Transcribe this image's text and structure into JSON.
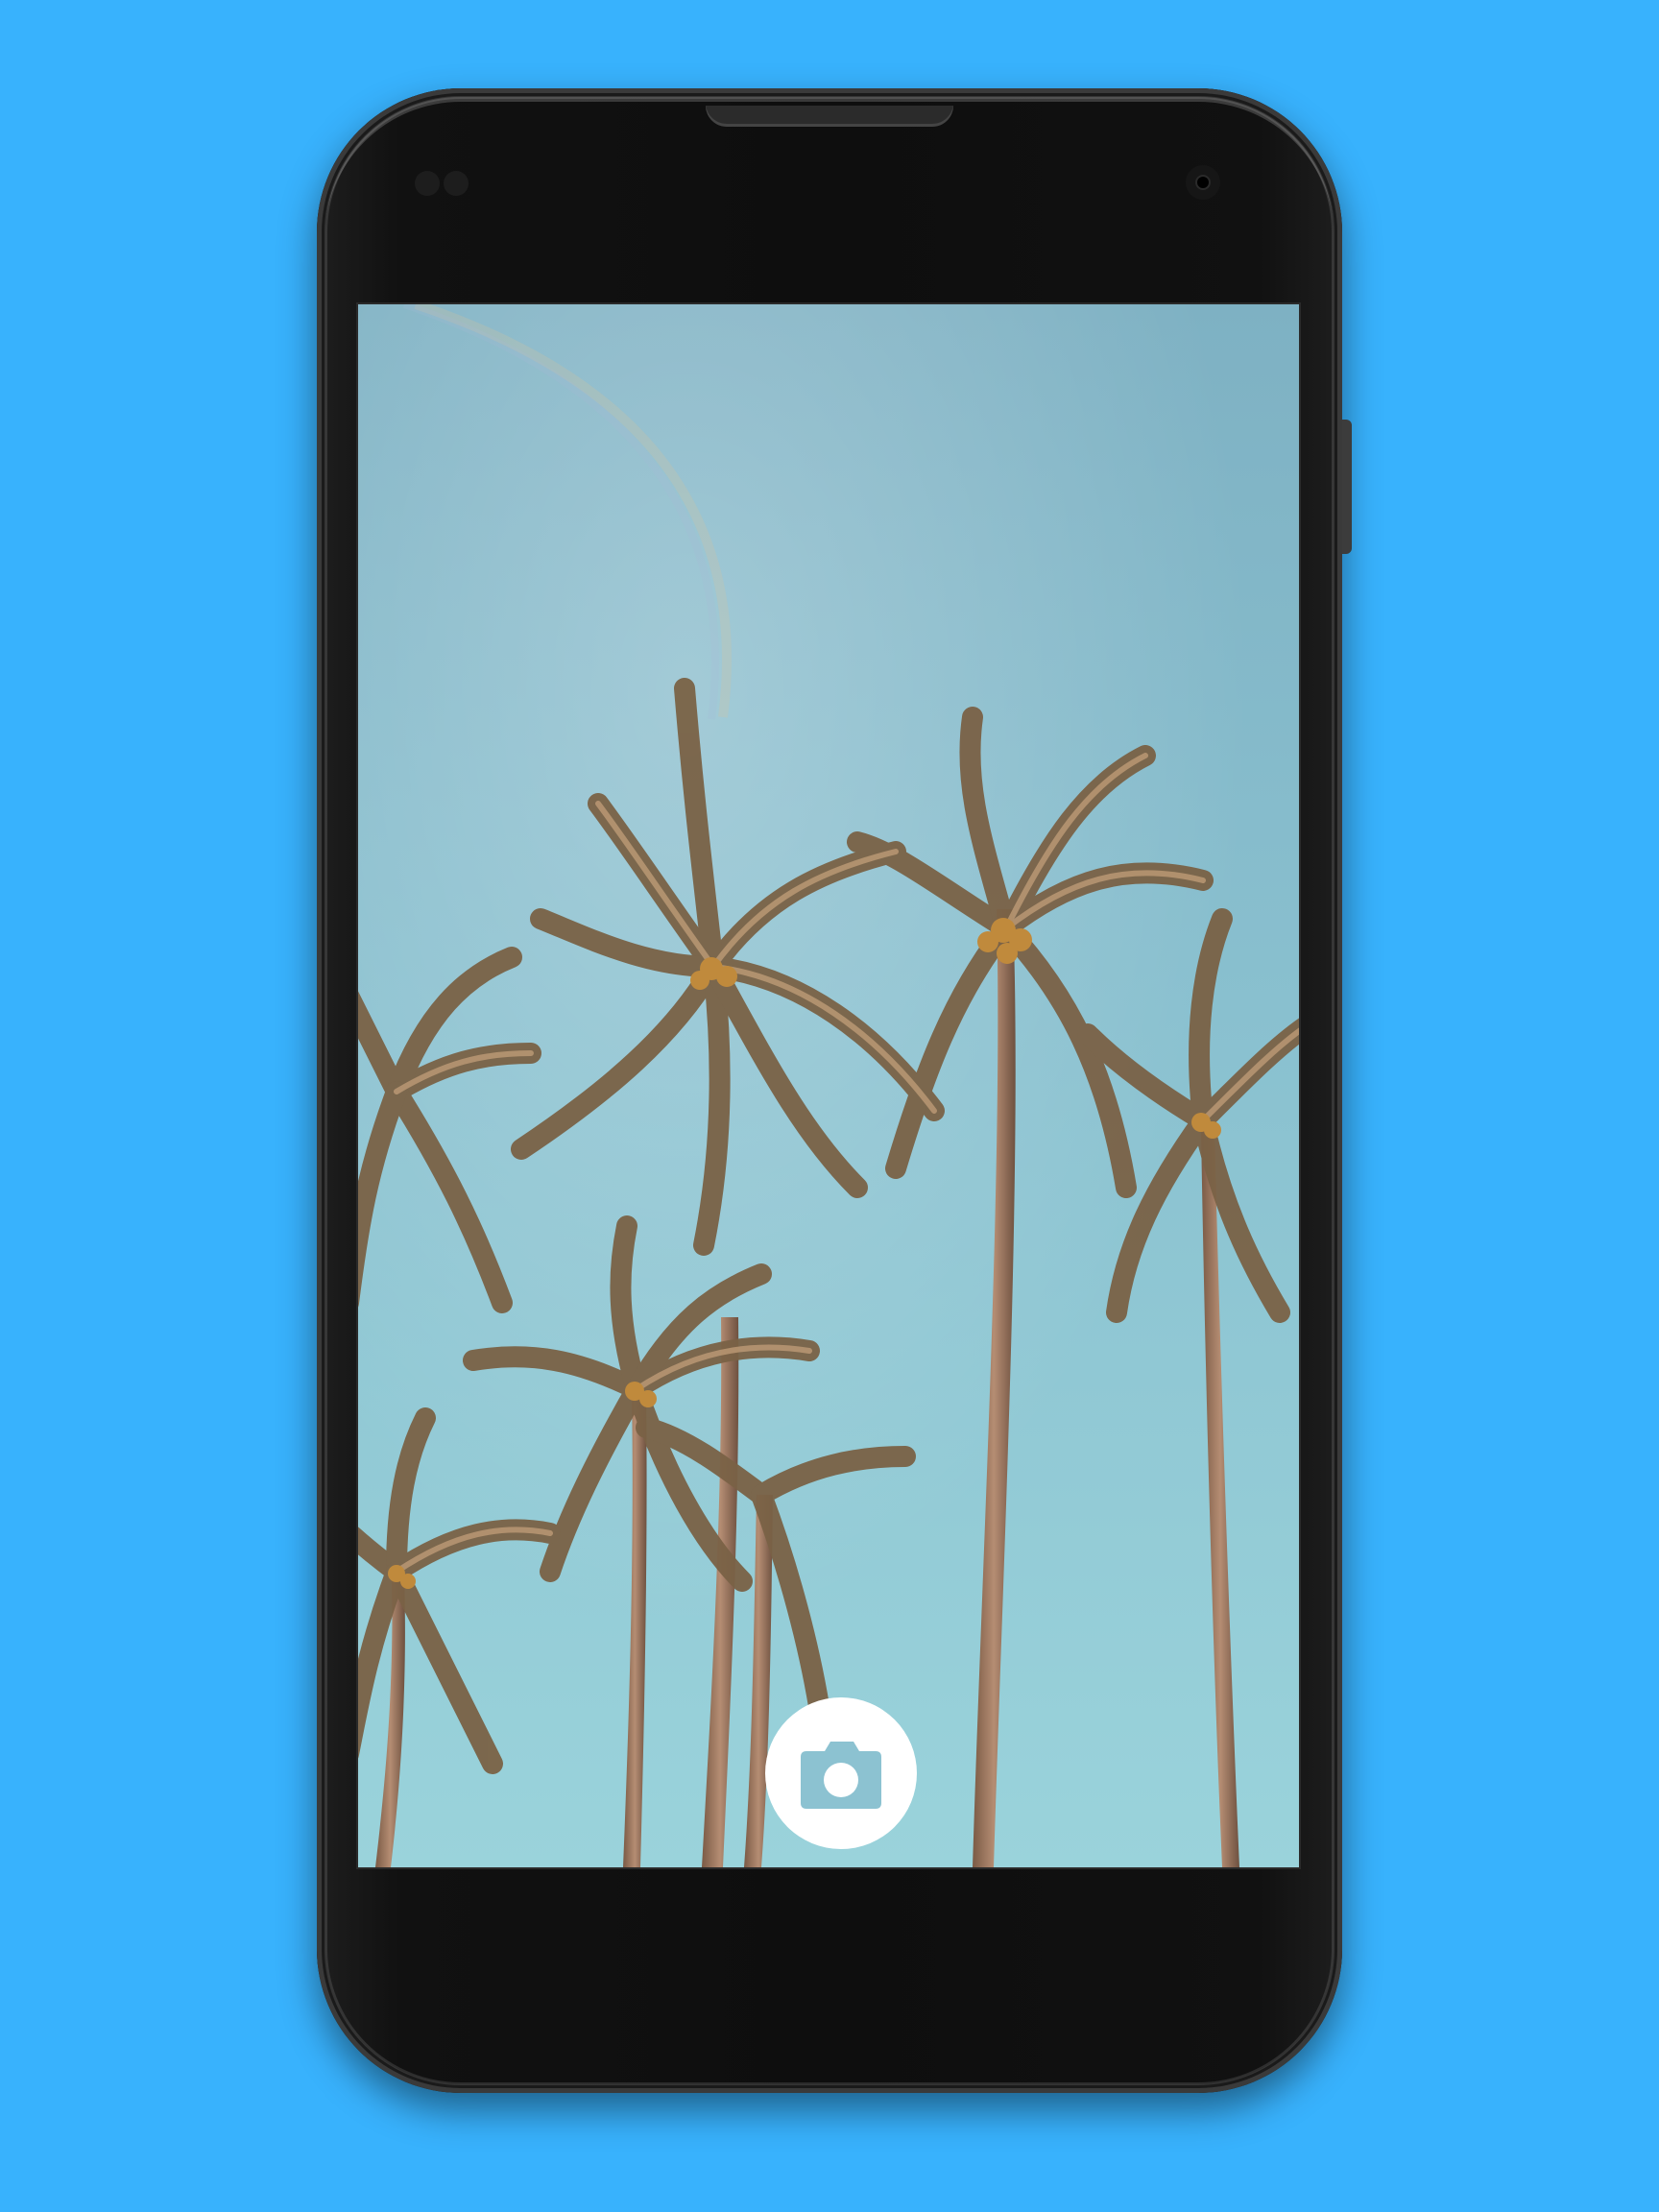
{
  "background": {
    "color": "#38b2fd"
  },
  "device": {
    "body_color": "#111111",
    "screen_image": "palm-trees-sky"
  },
  "capture_button": {
    "icon": "camera-icon",
    "background_color": "#ffffff",
    "icon_color": "#8cc2d1"
  }
}
